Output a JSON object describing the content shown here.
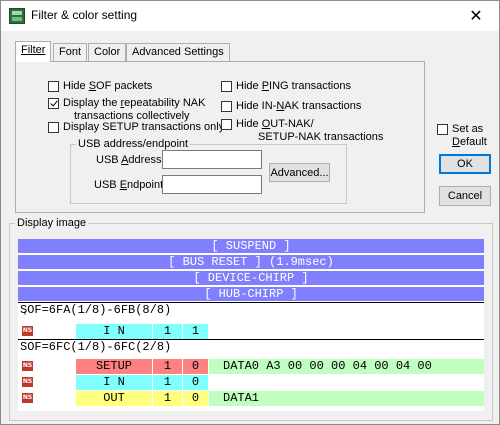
{
  "window": {
    "title": "Filter & color setting",
    "close_glyph": "✕"
  },
  "tabs": [
    {
      "label": "Filter",
      "active": true
    },
    {
      "label": "Font"
    },
    {
      "label": "Color"
    },
    {
      "label": "Advanced Settings"
    }
  ],
  "filter": {
    "hide_sof": {
      "pre": "Hide ",
      "key": "S",
      "post": "OF packets",
      "checked": false
    },
    "display_repeat": {
      "line1_pre": "Display the ",
      "line1_key": "r",
      "line1_post": "epeatability NAK",
      "line2": "transactions collectively",
      "checked": true
    },
    "display_setup": {
      "label": "Display SETUP transactions only",
      "checked": false
    },
    "hide_ping": {
      "pre": "Hide ",
      "key": "P",
      "post": "ING transactions",
      "checked": false
    },
    "hide_in_nak": {
      "pre": "Hide IN-",
      "key": "N",
      "post": "AK transactions",
      "checked": false
    },
    "hide_out_nak": {
      "line1_pre": "Hide ",
      "line1_key": "O",
      "line1_post": "UT-NAK/",
      "line2": "SETUP-NAK transactions",
      "checked": false
    }
  },
  "usb": {
    "group_label": "USB address/endpoint",
    "address_pre": "USB ",
    "address_key": "A",
    "address_post": "ddress :",
    "address_value": "",
    "endpoint_pre": "USB ",
    "endpoint_key": "E",
    "endpoint_post": "ndpoint :",
    "endpoint_value": "",
    "advanced_label": "Advanced..."
  },
  "set_default": {
    "line1": "Set as",
    "line2_key": "D",
    "line2_post": "efault",
    "checked": false
  },
  "buttons": {
    "ok": "OK",
    "cancel": "Cancel"
  },
  "display": {
    "label": "Display image",
    "bars": [
      "[ SUSPEND ]",
      "[ BUS RESET ] (1.9msec)",
      "[ DEVICE-CHIRP ]",
      "[ HUB-CHIRP ]"
    ],
    "bar_color": "#8080ff",
    "sof1": "SOF=6FA(1/8)-6FB(8/8)",
    "sof1_tick": "'",
    "sof2": "SOF=6FC(1/8)-6FC(2/8)",
    "ns_icon_text": "NS",
    "rows": [
      {
        "token": "I N",
        "f1": "1",
        "f2": "1",
        "color": "#80ffff",
        "data": ""
      },
      {
        "token": "SETUP",
        "f1": "1",
        "f2": "0",
        "color": "#ff8080",
        "data": "DATA0 A3 00 00 00 04 00 04 00"
      },
      {
        "token": "I N",
        "f1": "1",
        "f2": "0",
        "color": "#80ffff",
        "data": ""
      },
      {
        "token": "OUT",
        "f1": "1",
        "f2": "0",
        "color": "#ffff80",
        "data": "DATA1"
      }
    ],
    "data_color": "#c0ffc0"
  }
}
